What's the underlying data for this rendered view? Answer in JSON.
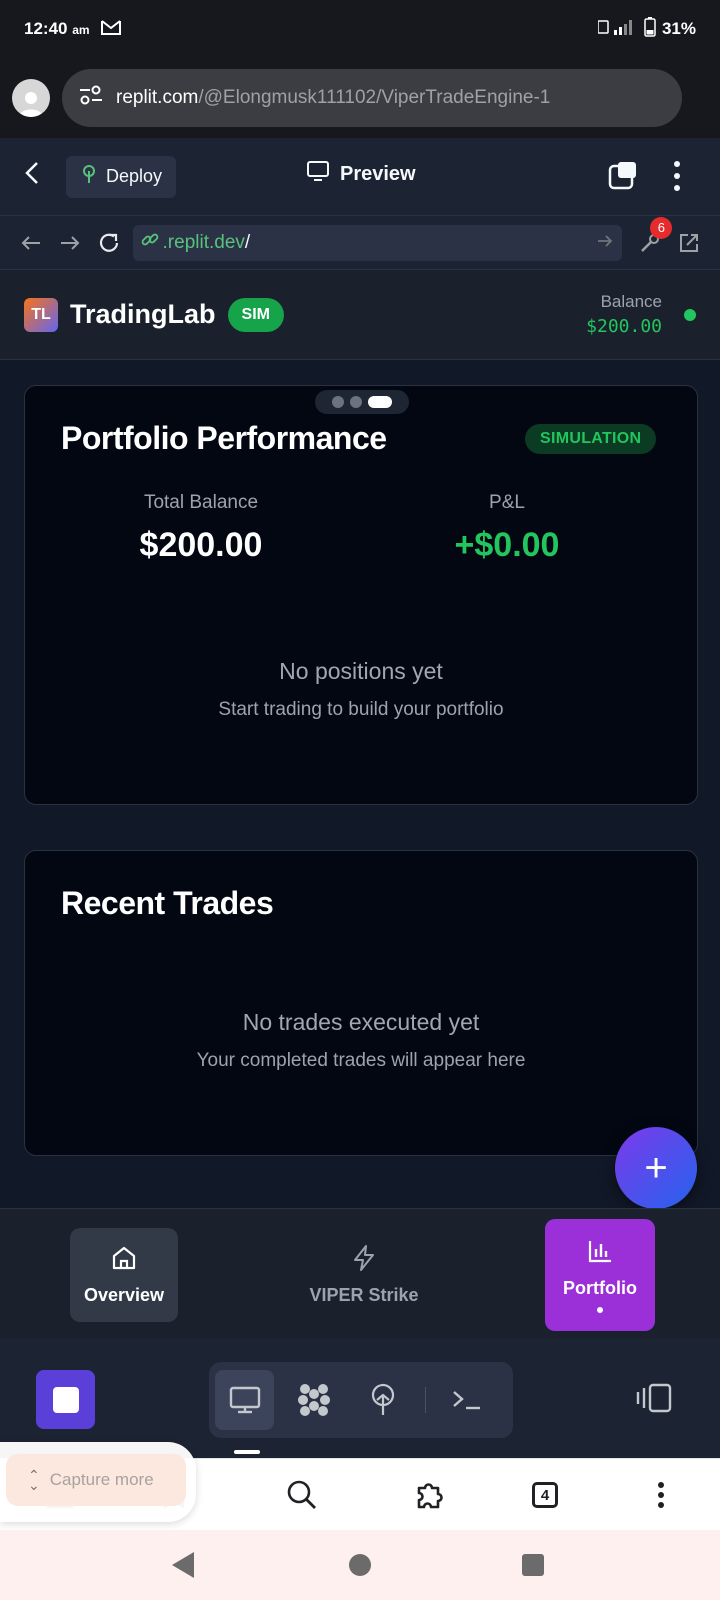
{
  "status_bar": {
    "time": "12:40",
    "ampm": "am",
    "battery": "31%"
  },
  "browser": {
    "url_host": "replit.com",
    "url_path": "/@Elongmusk111102/ViperTradeEngine-1"
  },
  "replit_header": {
    "deploy_label": "Deploy",
    "preview_label": "Preview"
  },
  "web_nav": {
    "url_domain": ".replit.dev",
    "url_path": "/",
    "devtools_badge": "6"
  },
  "app": {
    "logo_text": "TL",
    "brand": "TradingLab",
    "sim_badge": "SIM",
    "balance_label": "Balance",
    "balance_value": "$200.00"
  },
  "portfolio_card": {
    "title": "Portfolio Performance",
    "mode_badge": "SIMULATION",
    "total_balance_label": "Total Balance",
    "total_balance_value": "$200.00",
    "pnl_label": "P&L",
    "pnl_value": "+$0.00",
    "empty_title": "No positions yet",
    "empty_subtitle": "Start trading to build your portfolio"
  },
  "trades_card": {
    "title": "Recent Trades",
    "empty_title": "No trades executed yet",
    "empty_subtitle": "Your completed trades will appear here"
  },
  "fab_label": "+",
  "tabs": [
    {
      "label": "Overview",
      "icon": "home-icon"
    },
    {
      "label": "VIPER Strike",
      "icon": "lightning-icon"
    },
    {
      "label": "Portfolio",
      "icon": "bar-chart-icon",
      "active": true
    }
  ],
  "capture": {
    "label": "Capture more"
  },
  "browser_bottom": {
    "tab_count": "4"
  },
  "colors": {
    "accent_green": "#22c55e",
    "portfolio_purple": "#9b30d9",
    "replit_bg": "#1c2333"
  }
}
